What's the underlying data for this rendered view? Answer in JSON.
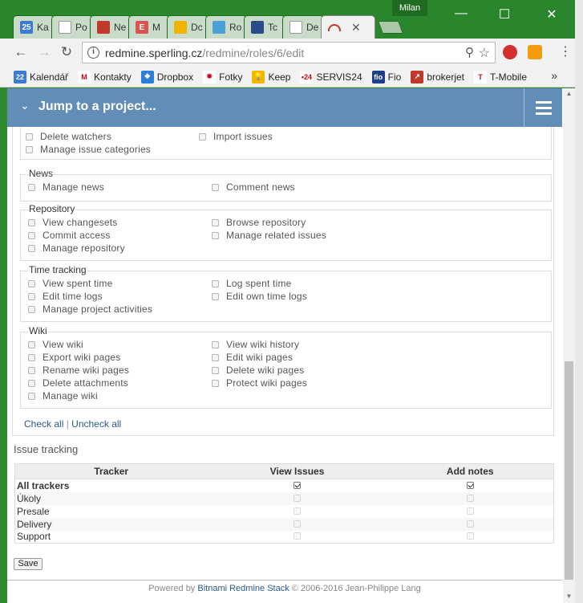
{
  "browser": {
    "profile": "Milan",
    "tabs": [
      {
        "label": "Ka",
        "icon": "calendar-icon",
        "color": "#3b7bd6",
        "glyph": "25"
      },
      {
        "label": "Po",
        "icon": "document-icon",
        "color": "#ffffff",
        "glyph": ""
      },
      {
        "label": "Ne",
        "icon": "redmine-icon",
        "color": "#c0392b",
        "glyph": ""
      },
      {
        "label": "M",
        "icon": "e-icon",
        "color": "#d9534f",
        "glyph": "E"
      },
      {
        "label": "Dc",
        "icon": "coin-icon",
        "color": "#f0b400",
        "glyph": ""
      },
      {
        "label": "Ro",
        "icon": "gear-icon",
        "color": "#4a9fd6",
        "glyph": ""
      },
      {
        "label": "Tc",
        "icon": "banana-icon",
        "color": "#2b4a8a",
        "glyph": ""
      },
      {
        "label": "De",
        "icon": "document-icon",
        "color": "#ffffff",
        "glyph": ""
      }
    ],
    "active_tab": {
      "icon": "redmine-icon",
      "close": "✕"
    },
    "url_host": "redmine.sperling.cz",
    "url_path": "/redmine/roles/6/edit",
    "bookmarks": [
      {
        "label": "Kalendář",
        "icon": "calendar-icon",
        "color": "#3b7bd6",
        "glyph": "22"
      },
      {
        "label": "Kontakty",
        "icon": "gmail-icon",
        "color": "#ffffff",
        "glyph": "M"
      },
      {
        "label": "Dropbox",
        "icon": "dropbox-icon",
        "color": "#2b7fd6",
        "glyph": "❖"
      },
      {
        "label": "Fotky",
        "icon": "photos-icon",
        "color": "#ffffff",
        "glyph": "✸"
      },
      {
        "label": "Keep",
        "icon": "keep-icon",
        "color": "#f5b400",
        "glyph": "💡"
      },
      {
        "label": "SERVIS24",
        "icon": "servis24-icon",
        "color": "#ffffff",
        "glyph": "•24"
      },
      {
        "label": "Fio",
        "icon": "fio-icon",
        "color": "#1d3f8a",
        "glyph": "fio"
      },
      {
        "label": "brokerjet",
        "icon": "brokerjet-icon",
        "color": "#c0392b",
        "glyph": "↗"
      },
      {
        "label": "T-Mobile",
        "icon": "tmobile-icon",
        "color": "#ffffff",
        "glyph": "T"
      }
    ],
    "bookmarks_more": "»"
  },
  "header": {
    "jump_label": "Jump to a project..."
  },
  "permissions": {
    "top": [
      {
        "label": "Delete watchers",
        "checked": false
      },
      {
        "label": "Import issues",
        "checked": false
      },
      {
        "label": "Manage issue categories",
        "checked": false
      }
    ],
    "groups": [
      {
        "legend": "News",
        "items": [
          {
            "label": "Manage news",
            "checked": false
          },
          {
            "label": "Comment news",
            "checked": false
          }
        ]
      },
      {
        "legend": "Repository",
        "items": [
          {
            "label": "View changesets",
            "checked": false
          },
          {
            "label": "Browse repository",
            "checked": false
          },
          {
            "label": "Commit access",
            "checked": false
          },
          {
            "label": "Manage related issues",
            "checked": false
          },
          {
            "label": "Manage repository",
            "checked": false
          }
        ]
      },
      {
        "legend": "Time tracking",
        "items": [
          {
            "label": "View spent time",
            "checked": false
          },
          {
            "label": "Log spent time",
            "checked": false
          },
          {
            "label": "Edit time logs",
            "checked": false
          },
          {
            "label": "Edit own time logs",
            "checked": false
          },
          {
            "label": "Manage project activities",
            "checked": false
          }
        ]
      },
      {
        "legend": "Wiki",
        "items": [
          {
            "label": "View wiki",
            "checked": false
          },
          {
            "label": "View wiki history",
            "checked": false
          },
          {
            "label": "Export wiki pages",
            "checked": false
          },
          {
            "label": "Edit wiki pages",
            "checked": false
          },
          {
            "label": "Rename wiki pages",
            "checked": false
          },
          {
            "label": "Delete wiki pages",
            "checked": false
          },
          {
            "label": "Delete attachments",
            "checked": false
          },
          {
            "label": "Protect wiki pages",
            "checked": false
          },
          {
            "label": "Manage wiki",
            "checked": false
          }
        ]
      }
    ],
    "check_all": "Check all",
    "separator": "|",
    "uncheck_all": "Uncheck all"
  },
  "issue_tracking": {
    "title": "Issue tracking",
    "columns": [
      "Tracker",
      "View Issues",
      "Add notes"
    ],
    "rows": [
      {
        "name": "All trackers",
        "bold": true,
        "view": true,
        "notes": true,
        "enabled": true
      },
      {
        "name": "Úkoly",
        "bold": false,
        "view": false,
        "notes": false,
        "enabled": false
      },
      {
        "name": "Presale",
        "bold": false,
        "view": false,
        "notes": false,
        "enabled": false
      },
      {
        "name": "Delivery",
        "bold": false,
        "view": false,
        "notes": false,
        "enabled": false
      },
      {
        "name": "Support",
        "bold": false,
        "view": false,
        "notes": false,
        "enabled": false
      }
    ]
  },
  "save_label": "Save",
  "footer": {
    "prefix": "Powered by",
    "link": "Bitnami Redmine Stack",
    "suffix": "© 2006-2016 Jean-Philippe Lang"
  }
}
